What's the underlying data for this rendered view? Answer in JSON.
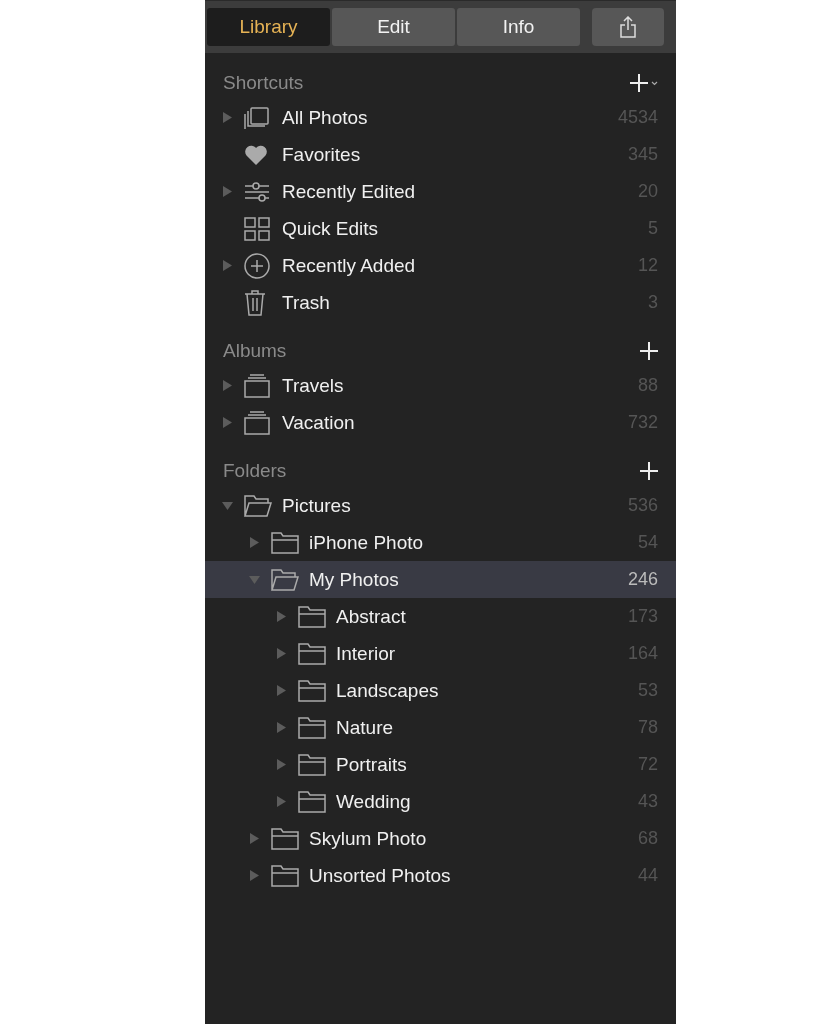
{
  "tabs": [
    {
      "label": "Library",
      "selected": true
    },
    {
      "label": "Edit",
      "selected": false
    },
    {
      "label": "Info",
      "selected": false
    }
  ],
  "sections": [
    {
      "title": "Shortcuts",
      "add_menu": true,
      "items": [
        {
          "label": "All Photos",
          "count": "4534",
          "kind": "stack",
          "expanded": false,
          "selected": false
        },
        {
          "label": "Favorites",
          "count": "345",
          "kind": "heart",
          "selected": false
        },
        {
          "label": "Recently Edited",
          "count": "20",
          "kind": "sliders",
          "expanded": false,
          "selected": false
        },
        {
          "label": "Quick Edits",
          "count": "5",
          "kind": "grid",
          "selected": false
        },
        {
          "label": "Recently Added",
          "count": "12",
          "kind": "plus-circle",
          "expanded": false,
          "selected": false
        },
        {
          "label": "Trash",
          "count": "3",
          "kind": "trash",
          "selected": false
        }
      ]
    },
    {
      "title": "Albums",
      "add_menu": false,
      "items": [
        {
          "label": "Travels",
          "count": "88",
          "kind": "album",
          "expanded": false,
          "selected": false
        },
        {
          "label": "Vacation",
          "count": "732",
          "kind": "album",
          "expanded": false,
          "selected": false
        }
      ]
    },
    {
      "title": "Folders",
      "add_menu": false,
      "items": [
        {
          "label": "Pictures",
          "count": "536",
          "kind": "folder",
          "expanded": true,
          "selected": false,
          "children": [
            {
              "label": "iPhone Photo",
              "count": "54",
              "kind": "folder",
              "expanded": false,
              "selected": false
            },
            {
              "label": "My Photos",
              "count": "246",
              "kind": "folder",
              "expanded": true,
              "selected": true,
              "children": [
                {
                  "label": "Abstract",
                  "count": "173",
                  "kind": "folder",
                  "expanded": false,
                  "selected": false
                },
                {
                  "label": "Interior",
                  "count": "164",
                  "kind": "folder",
                  "expanded": false,
                  "selected": false
                },
                {
                  "label": "Landscapes",
                  "count": "53",
                  "kind": "folder",
                  "expanded": false,
                  "selected": false
                },
                {
                  "label": "Nature",
                  "count": "78",
                  "kind": "folder",
                  "expanded": false,
                  "selected": false
                },
                {
                  "label": "Portraits",
                  "count": "72",
                  "kind": "folder",
                  "expanded": false,
                  "selected": false
                },
                {
                  "label": "Wedding",
                  "count": "43",
                  "kind": "folder",
                  "expanded": false,
                  "selected": false
                }
              ]
            },
            {
              "label": "Skylum Photo",
              "count": "68",
              "kind": "folder",
              "expanded": false,
              "selected": false
            },
            {
              "label": "Unsorted Photos",
              "count": "44",
              "kind": "folder",
              "expanded": false,
              "selected": false
            }
          ]
        }
      ]
    }
  ]
}
